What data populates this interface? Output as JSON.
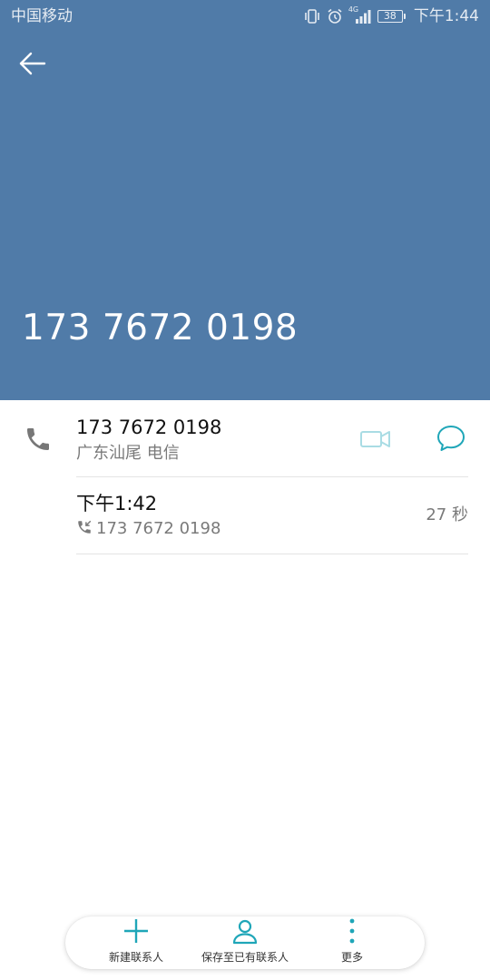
{
  "status_bar": {
    "carrier": "中国移动",
    "network": "4G",
    "battery": "38",
    "time": "下午1:44"
  },
  "header": {
    "number": "173 7672 0198",
    "back_icon": "arrow-left-icon"
  },
  "detail": {
    "number": "173 7672 0198",
    "location": "广东汕尾 电信",
    "video_icon": "video-call-icon",
    "message_icon": "message-icon"
  },
  "call_log": {
    "time": "下午1:42",
    "number": "173 7672 0198",
    "duration": "27 秒",
    "type_icon": "incoming-call-icon"
  },
  "bottom_bar": {
    "new_contact": "新建联系人",
    "save_existing": "保存至已有联系人",
    "more": "更多"
  },
  "colors": {
    "header_bg": "#507BA8",
    "accent": "#1FA6B8",
    "video_icon": "#A9DCE4"
  }
}
